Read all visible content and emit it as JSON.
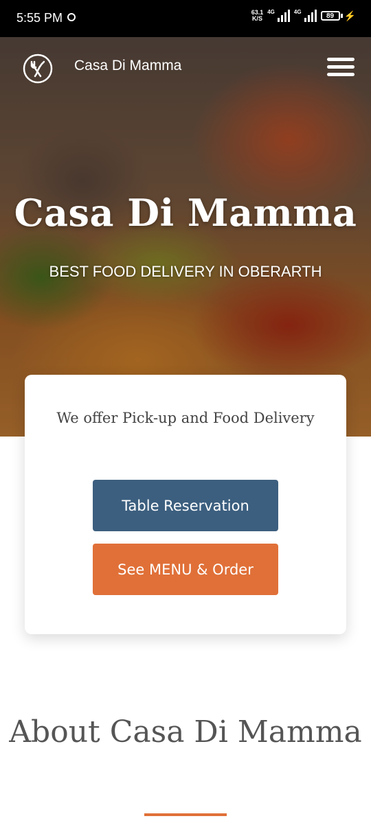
{
  "status_bar": {
    "time": "5:55 PM",
    "net_speed_value": "63.1",
    "net_speed_unit": "K/S",
    "signal1_label": "4G",
    "signal2_label": "4G",
    "battery": "89"
  },
  "header": {
    "brand": "Casa Di Mamma",
    "logo_icon": "fork-knife-icon",
    "menu_icon": "hamburger-menu-icon"
  },
  "hero": {
    "title": "Casa Di Mamma",
    "subtitle": "BEST FOOD DELIVERY IN OBERARTH"
  },
  "card": {
    "text": "We offer Pick-up and Food Delivery",
    "reservation_button": "Table Reservation",
    "menu_button": "See MENU & Order"
  },
  "about": {
    "title": "About Casa Di Mamma"
  },
  "colors": {
    "primary_blue": "#3c5f7f",
    "accent_orange": "#e07038"
  }
}
